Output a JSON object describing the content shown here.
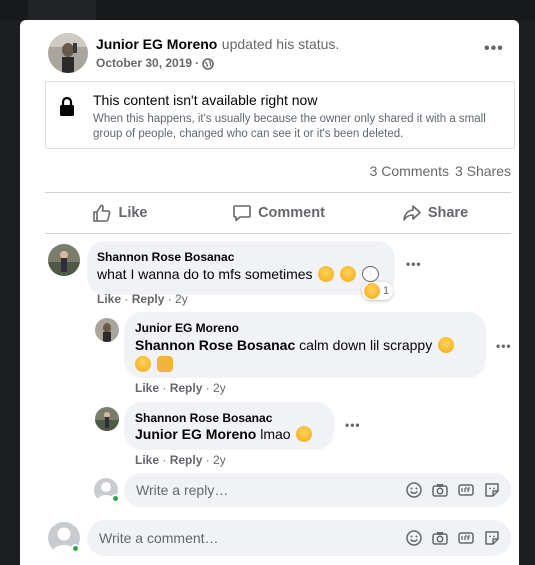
{
  "post": {
    "author": "Junior EG Moreno",
    "action_text": "updated his status.",
    "date": "October 30, 2019",
    "separator": "·",
    "privacy_icon": "globe-icon",
    "more_label": "•••"
  },
  "notice": {
    "icon": "lock-icon",
    "title": "This content isn't available right now",
    "body": "When this happens, it's usually because the owner only shared it with a small group of people, changed who can see it or it's been deleted."
  },
  "stats": {
    "comments": "3 Comments",
    "shares": "3 Shares"
  },
  "actions": {
    "like": "Like",
    "comment": "Comment",
    "share": "Share"
  },
  "comments": [
    {
      "author": "Shannon Rose Bosanac",
      "text": "what I wanna do to mfs sometimes",
      "reaction_count": "1",
      "like": "Like",
      "reply": "Reply",
      "age": "2y"
    }
  ],
  "replies": [
    {
      "author": "Junior EG Moreno",
      "mention": "Shannon Rose Bosanac",
      "text": "calm down lil scrappy",
      "like": "Like",
      "reply": "Reply",
      "age": "2y"
    },
    {
      "author": "Shannon Rose Bosanac",
      "mention": "Junior EG Moreno",
      "text": "lmao",
      "like": "Like",
      "reply": "Reply",
      "age": "2y"
    }
  ],
  "reply_input": {
    "placeholder": "Write a reply…"
  },
  "comment_input": {
    "placeholder": "Write a comment…"
  },
  "colors": {
    "background": "#1c1e21",
    "card": "#ffffff",
    "bubble": "#f0f2f5",
    "secondary_text": "#65676b",
    "online": "#31a24c"
  }
}
